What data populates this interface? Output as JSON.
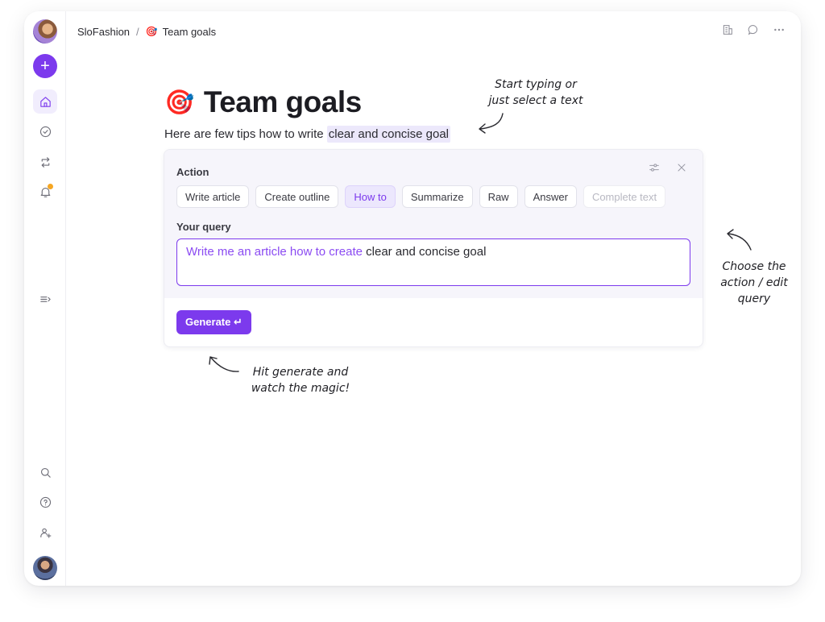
{
  "breadcrumb": {
    "workspace": "SloFashion",
    "separator": "/",
    "page_icon": "🎯",
    "page": "Team goals"
  },
  "sidebar": {
    "items": [
      {
        "icon": "home-icon",
        "active": true
      },
      {
        "icon": "check-circle-icon",
        "active": false
      },
      {
        "icon": "sync-icon",
        "active": false
      },
      {
        "icon": "bell-icon",
        "active": false,
        "badge": true
      },
      {
        "icon": "collapse-icon",
        "active": false
      },
      {
        "icon": "search-icon",
        "active": false
      },
      {
        "icon": "help-icon",
        "active": false
      },
      {
        "icon": "add-user-icon",
        "active": false
      }
    ]
  },
  "top_actions": [
    "building-icon",
    "comment-icon",
    "more-icon"
  ],
  "page": {
    "title_icon": "🎯",
    "title": "Team goals",
    "subtitle_prefix": "Here are few tips how to write ",
    "subtitle_highlight": "clear and concise goal"
  },
  "ai_panel": {
    "action_label": "Action",
    "actions": [
      {
        "label": "Write article",
        "state": "normal"
      },
      {
        "label": "Create outline",
        "state": "normal"
      },
      {
        "label": "How to",
        "state": "active"
      },
      {
        "label": "Summarize",
        "state": "normal"
      },
      {
        "label": "Raw",
        "state": "normal"
      },
      {
        "label": "Answer",
        "state": "normal"
      },
      {
        "label": "Complete text",
        "state": "faded"
      }
    ],
    "query_label": "Your query",
    "query_prefix": "Write me an article how to create ",
    "query_text": "clear and concise goal",
    "generate_label": "Generate ↵"
  },
  "annotations": {
    "top": [
      "Start typing or",
      "just select a text"
    ],
    "right": [
      "Choose the",
      "action / edit",
      "query"
    ],
    "bottom": [
      "Hit generate and",
      "watch the magic!"
    ]
  },
  "colors": {
    "accent": "#7c3aed",
    "accent_light": "#ece7fd",
    "highlight": "#ece8fb",
    "notification": "#f5a623"
  }
}
